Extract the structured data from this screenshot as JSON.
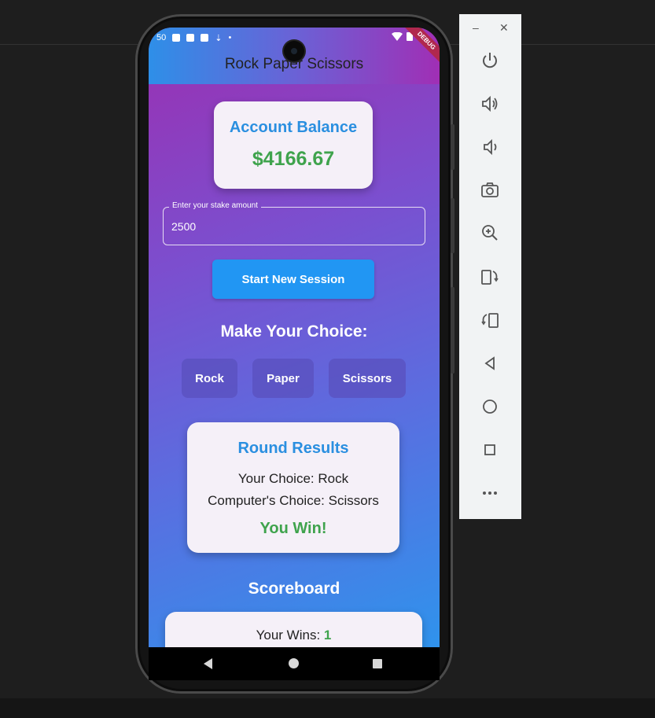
{
  "app": {
    "title": "Rock Paper Scissors",
    "debug_banner": "DEBUG",
    "status_time": "50"
  },
  "balance": {
    "title": "Account Balance",
    "amount": "$4166.67"
  },
  "stake": {
    "label": "Enter your stake amount",
    "value": "2500"
  },
  "actions": {
    "start_session": "Start New Session"
  },
  "choices": {
    "heading": "Make Your Choice:",
    "options": [
      "Rock",
      "Paper",
      "Scissors"
    ]
  },
  "results": {
    "title": "Round Results",
    "your_choice": "Your Choice: Rock",
    "computer_choice": "Computer's Choice: Scissors",
    "outcome": "You Win!"
  },
  "scoreboard": {
    "heading": "Scoreboard",
    "wins_label": "Your Wins: ",
    "wins_value": "1"
  },
  "emulator_panel": {
    "minimize": "–",
    "close": "✕",
    "tools": [
      "power-icon",
      "volume-up-icon",
      "volume-down-icon",
      "camera-icon",
      "zoom-icon",
      "rotate-left-icon",
      "rotate-right-icon",
      "back-icon",
      "home-icon",
      "overview-icon",
      "more-icon"
    ]
  },
  "colors": {
    "accent_blue": "#2196f3",
    "win_green": "#3fa34d",
    "gradient_purple": "#9b2fb1",
    "gradient_blue": "#2f93ec"
  }
}
